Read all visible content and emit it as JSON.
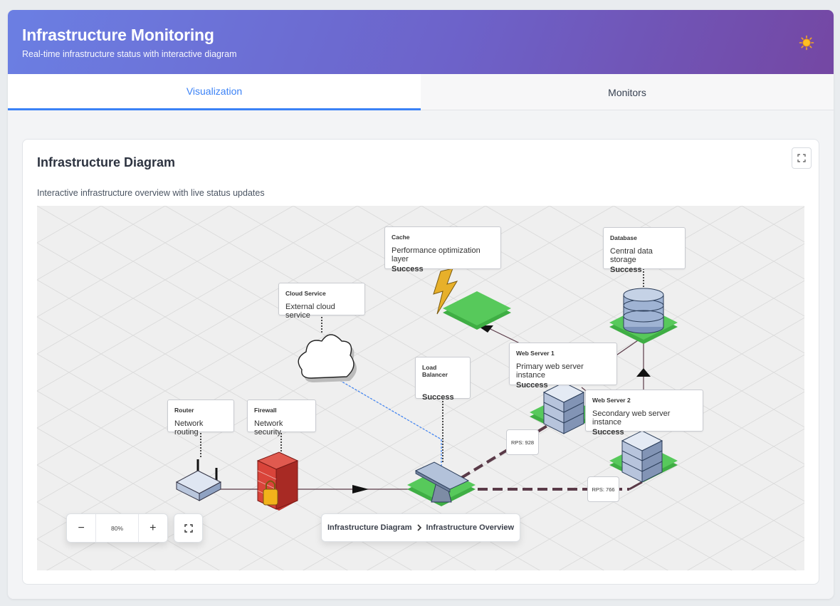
{
  "header": {
    "title": "Infrastructure Monitoring",
    "subtitle": "Real-time infrastructure status with interactive diagram",
    "theme_icon": "sun-icon"
  },
  "tabs": [
    {
      "label": "Visualization",
      "active": true
    },
    {
      "label": "Monitors",
      "active": false
    }
  ],
  "card": {
    "title": "Infrastructure Diagram",
    "description": "Interactive infrastructure overview with live status updates",
    "expand_icon": "expand-icon"
  },
  "nodes": {
    "cache": {
      "name": "Cache",
      "description": "Performance optimization layer",
      "status": "Success"
    },
    "database": {
      "name": "Database",
      "description": "Central data storage",
      "status": "Success"
    },
    "cloud": {
      "name": "Cloud Service",
      "description": "External cloud service"
    },
    "load_balancer": {
      "name": "Load Balancer",
      "status": "Success"
    },
    "web1": {
      "name": "Web Server 1",
      "description": "Primary web server instance",
      "status": "Success"
    },
    "web2": {
      "name": "Web Server 2",
      "description": "Secondary web server instance",
      "status": "Success"
    },
    "router": {
      "name": "Router",
      "description": "Network routing"
    },
    "firewall": {
      "name": "Firewall",
      "description": "Network security"
    }
  },
  "edges": {
    "lb_web1_rps": "RPS: 928",
    "lb_web2_rps": "RPS: 766"
  },
  "colors": {
    "status_success": "#4cc24f",
    "accent": "#3b82f6",
    "connection": "#5a3a48",
    "cloud_link": "#3b82f6"
  },
  "zoom": {
    "value": "80%",
    "minus": "−",
    "plus": "+"
  },
  "breadcrumb": {
    "root": "Infrastructure Diagram",
    "current": "Infrastructure Overview"
  }
}
